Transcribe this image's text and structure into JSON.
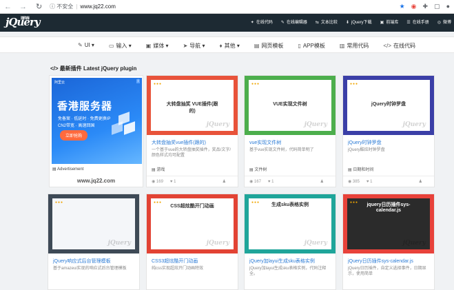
{
  "browser": {
    "nav_back": "←",
    "nav_forward": "→",
    "nav_reload": "↻",
    "security": "不安全",
    "url": "www.jq22.com"
  },
  "site": {
    "logo": "jQuery",
    "logo_small": "插件库",
    "top_links": [
      {
        "icon": "✦",
        "label": "在线代码"
      },
      {
        "icon": "✎",
        "label": "在线编辑器"
      },
      {
        "icon": "⇆",
        "label": "文本比较"
      },
      {
        "icon": "⬇",
        "label": "jQuery下载"
      },
      {
        "icon": "▣",
        "label": "前端库"
      },
      {
        "icon": "☰",
        "label": "在线手册"
      },
      {
        "icon": "◎",
        "label": "微博"
      }
    ],
    "menu": [
      {
        "icon": "✎",
        "label": "UI ▾"
      },
      {
        "icon": "▭",
        "label": "输入 ▾"
      },
      {
        "icon": "▣",
        "label": "媒体 ▾"
      },
      {
        "icon": "➤",
        "label": "导航 ▾"
      },
      {
        "icon": "♦",
        "label": "其他 ▾"
      },
      {
        "icon": "▤",
        "label": "网页模板"
      },
      {
        "icon": "▯",
        "label": "APP模板"
      },
      {
        "icon": "▥",
        "label": "常用代码"
      },
      {
        "icon": "</>",
        "label": "在线代码"
      }
    ]
  },
  "section": {
    "title": "最新插件 Latest jQuery plugin"
  },
  "ad": {
    "top": "阿里云",
    "info": "i",
    "headline": "香港服务器",
    "line1": "免备案 · 低延时 · 免费更换IP",
    "line2": "CN2带宽 · 高速回国",
    "button": "立即抢购",
    "label": "Advertisement",
    "site": "www.jq22.com"
  },
  "cards": [
    {
      "title": "大转盘抽奖vue插件(跟的)",
      "desc": "一个基于vue的大转盘抽奖插件，奖品/文字/颜色样式均可配置",
      "tag": "游戏",
      "views": "169",
      "likes": "1",
      "thumb_title": "大转盘抽奖 VUE插件(跟的)",
      "color": "#e8533a"
    },
    {
      "title": "vue实现文件树",
      "desc": "基于vue实现文件树，代码简单明了",
      "tag": "文件树",
      "views": "167",
      "likes": "1",
      "thumb_title": "VUE实现文件树",
      "color": "#4cae4c"
    },
    {
      "title": "jQuery时钟罗盘",
      "desc": "jQuery酷炫时钟罗盘",
      "tag": "日期和时间",
      "views": "385",
      "likes": "1",
      "thumb_title": "jQuery时钟罗盘",
      "color": "#3b3fa7"
    },
    {
      "title": "jQuery响应式后台管理模板",
      "desc": "基于amazeui实现的响应式后台管理模板",
      "tag": "",
      "views": "",
      "likes": "",
      "thumb_title": "",
      "color": "#3e4a56"
    },
    {
      "title": "CSS3超炫酷开门动画",
      "desc": "纯css实现超炫开门动画特效",
      "tag": "",
      "views": "",
      "likes": "",
      "thumb_title": "CSS超炫酷开门动画",
      "color": "#e24334"
    },
    {
      "title": "jQuery加layui生成sku表格实例",
      "desc": "jQuery加layui生成sku表格实例，代码注释全。",
      "tag": "",
      "views": "",
      "likes": "",
      "thumb_title": "生成sku表格实例",
      "color": "#1fa59a"
    },
    {
      "title": "jQuery日历插件sys-calendar.js",
      "desc": "jQuery日历插件，自定义选择事件，日期显示，使用简单",
      "tag": "",
      "views": "",
      "likes": "",
      "thumb_title": "jquery日历插件sys-calendar.js",
      "color": "#e8423a"
    }
  ],
  "watermark": "jQuery"
}
